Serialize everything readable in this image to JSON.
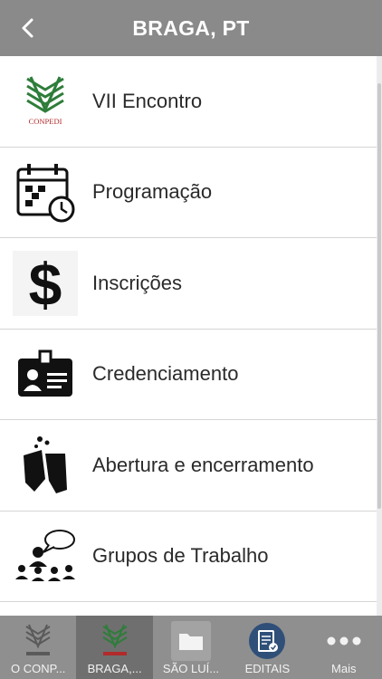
{
  "header": {
    "title": "BRAGA, PT"
  },
  "menu": [
    {
      "label": "VII Encontro",
      "icon": "conpedi-logo-icon"
    },
    {
      "label": "Programação",
      "icon": "calendar-clock-icon"
    },
    {
      "label": "Inscrições",
      "icon": "dollar-icon"
    },
    {
      "label": "Credenciamento",
      "icon": "id-badge-icon"
    },
    {
      "label": "Abertura e encerramento",
      "icon": "toast-glasses-icon"
    },
    {
      "label": "Grupos de Trabalho",
      "icon": "group-discussion-icon"
    }
  ],
  "logo_text": "CONPEDI",
  "tabs": [
    {
      "label": "O CONP...",
      "icon": "conpedi-logo-icon"
    },
    {
      "label": "BRAGA,...",
      "icon": "conpedi-logo-icon"
    },
    {
      "label": "SÃO LUÍ...",
      "icon": "folder-icon"
    },
    {
      "label": "EDITAIS",
      "icon": "document-check-icon"
    },
    {
      "label": "Mais",
      "icon": "more-dots-icon"
    }
  ],
  "colors": {
    "header_bg": "#8a8a8a",
    "tabbar_bg": "#8f8f8f",
    "active_tab_bg": "#6f6f6f",
    "logo_green": "#2e7d3a",
    "logo_red": "#b22a2a",
    "editais_blue": "#2f4f78"
  }
}
